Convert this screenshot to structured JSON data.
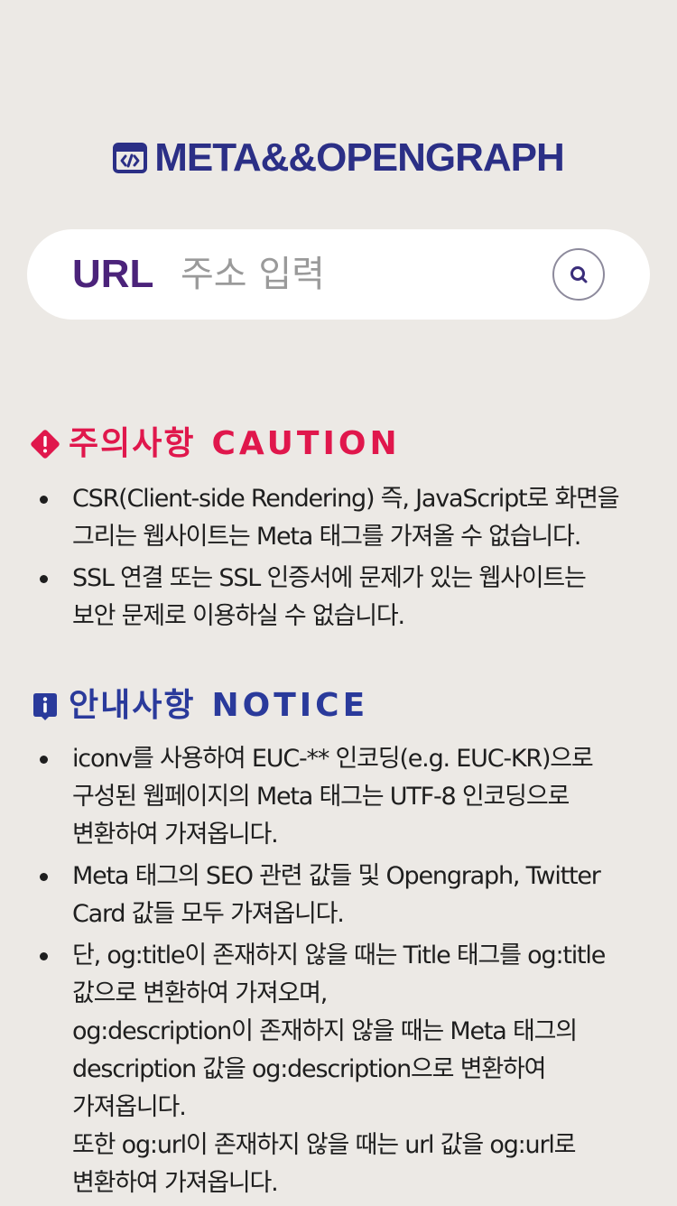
{
  "header": {
    "logo_text": "META&&OPENGRAPH",
    "logo_icon": "code-brackets-icon",
    "brand_color": "#2b2f86"
  },
  "search": {
    "label": "URL",
    "placeholder": "주소 입력",
    "value": "",
    "button_icon": "search-icon"
  },
  "caution": {
    "title_ko": "주의사항",
    "title_en": "CAUTION",
    "icon": "warning-diamond-icon",
    "color": "#e0174c",
    "items": [
      {
        "lines": [
          "CSR(Client-side Rendering) 즉, JavaScript로 화면을",
          "그리는 웹사이트는 Meta 태그를 가져올 수 없습니다."
        ]
      },
      {
        "lines": [
          "SSL 연결 또는 SSL 인증서에 문제가 있는 웹사이트는",
          "보안 문제로 이용하실 수 없습니다."
        ]
      }
    ]
  },
  "notice": {
    "title_ko": "안내사항",
    "title_en": "NOTICE",
    "icon": "info-badge-icon",
    "color": "#2a3a9b",
    "items": [
      {
        "lines": [
          "iconv를 사용하여 EUC-** 인코딩(e.g. EUC-KR)으로",
          "구성된 웹페이지의 Meta 태그는 UTF-8 인코딩으로",
          "변환하여 가져옵니다."
        ]
      },
      {
        "lines": [
          "Meta 태그의 SEO 관련 값들 및 Opengraph, Twitter",
          "Card 값들 모두 가져옵니다."
        ]
      },
      {
        "lines": [
          "단, og:title이 존재하지 않을 때는 Title 태그를 og:title",
          "값으로 변환하여 가져오며,",
          "og:description이 존재하지 않을 때는 Meta 태그의",
          "description 값을 og:description으로 변환하여",
          "가져옵니다.",
          "또한 og:url이 존재하지 않을 때는 url 값을 og:url로",
          "변환하여 가져옵니다."
        ]
      }
    ]
  }
}
